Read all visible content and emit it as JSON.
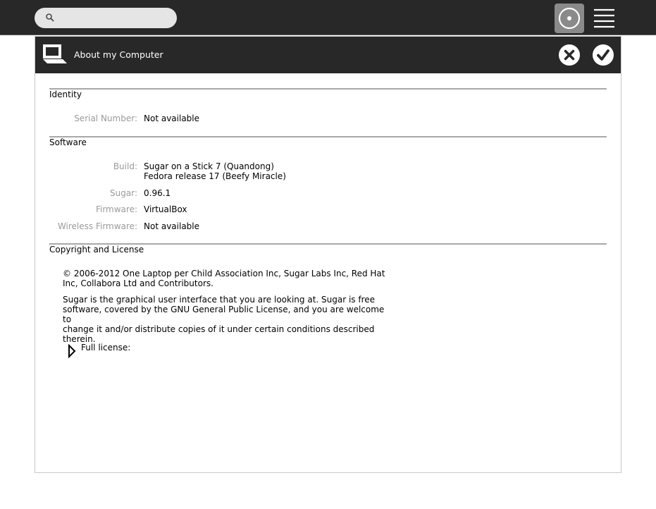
{
  "topbar": {
    "search": {
      "placeholder": ""
    },
    "icons": {
      "search": "search-icon",
      "home": "home-view-icon",
      "list": "list-view-icon"
    }
  },
  "dialog": {
    "title": "About my Computer",
    "icons": {
      "computer": "computer-icon",
      "cancel": "cancel-icon",
      "ok": "ok-icon"
    }
  },
  "identity": {
    "title": "Identity",
    "serial_label": "Serial Number:",
    "serial_value": "Not available"
  },
  "software": {
    "title": "Software",
    "build_label": "Build:",
    "build_value_line1": "Sugar on a Stick 7 (Quandong)",
    "build_value_line2": "Fedora release 17 (Beefy Miracle)",
    "sugar_label": "Sugar:",
    "sugar_value": "0.96.1",
    "firmware_label": "Firmware:",
    "firmware_value": "VirtualBox",
    "wireless_label": "Wireless Firmware:",
    "wireless_value": "Not available"
  },
  "license": {
    "title": "Copyright and License",
    "copyright_line1": "© 2006-2012 One Laptop per Child Association Inc, Sugar Labs Inc, Red Hat",
    "copyright_line2": "Inc, Collabora Ltd and Contributors.",
    "desc_line1": "Sugar is the graphical user interface that you are looking at. Sugar is free",
    "desc_line2": "software, covered by the GNU General Public License, and you are welcome to",
    "desc_line3": "change it and/or distribute copies of it under certain conditions described",
    "desc_line4": "therein.",
    "full_license_label": "Full license:"
  },
  "colors": {
    "bar_background": "#282828",
    "home_button_background": "#8a8a8a",
    "label_gray": "#9a9a9a",
    "separator": "#a8a8a8"
  }
}
